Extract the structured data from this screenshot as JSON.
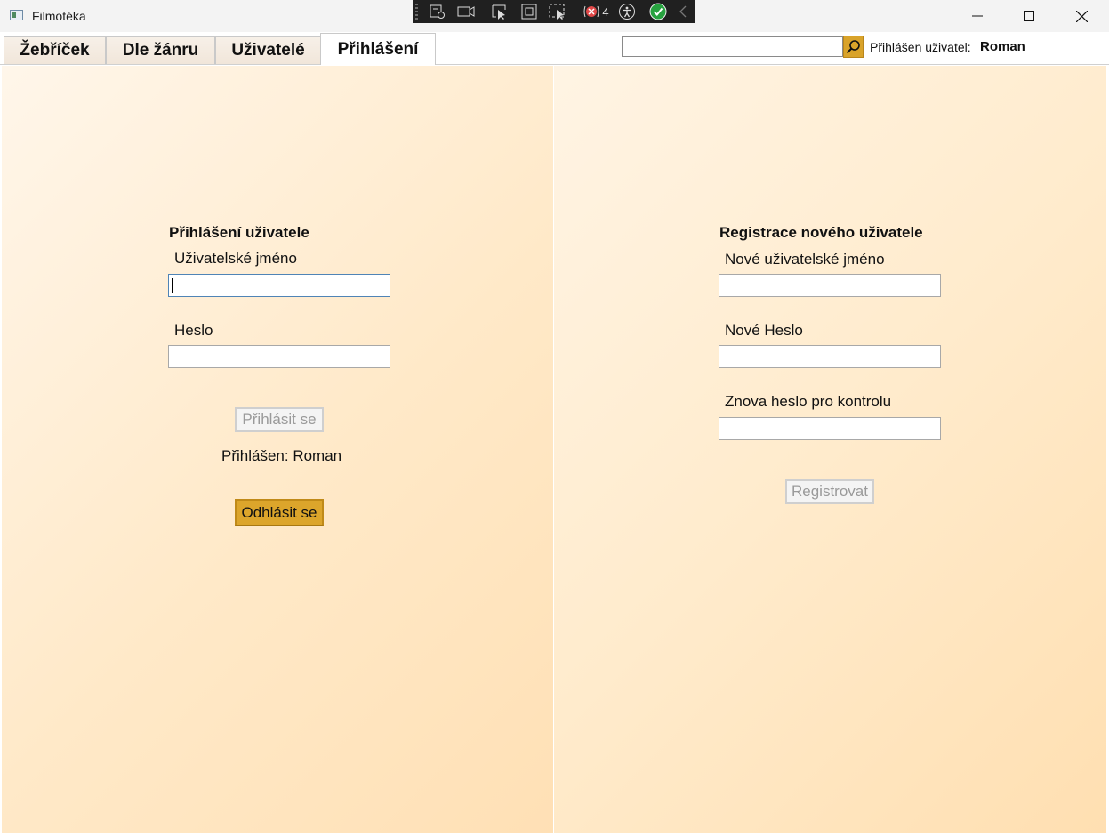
{
  "window": {
    "title": "Filmotéka",
    "icon": "app-window-icon",
    "controls": [
      "minimize-icon",
      "maximize-icon",
      "close-icon"
    ]
  },
  "debug_toolbar": {
    "icons": [
      "live-visual-tree-icon",
      "camera-icon",
      "select-element-icon",
      "display-layout-adorners-icon",
      "track-focus-icon",
      "binding-failures-icon",
      "accessibility-icon",
      "check-icon",
      "chevron-left-icon"
    ],
    "binding_failures_count": "4"
  },
  "tabs": [
    {
      "label": "Žebříček",
      "active": false
    },
    {
      "label": "Dle žánru",
      "active": false
    },
    {
      "label": "Uživatelé",
      "active": false
    },
    {
      "label": "Přihlášení",
      "active": true
    }
  ],
  "header": {
    "search_value": "",
    "search_icon": "search-icon",
    "logged_label": "Přihlášen uživatel:",
    "logged_user": "Roman"
  },
  "login": {
    "title": "Přihlášení uživatele",
    "username_label": "Uživatelské jméno",
    "username_value": "",
    "password_label": "Heslo",
    "password_value": "",
    "login_button": "Přihlásit se",
    "status": "Přihlášen: Roman",
    "logout_button": "Odhlásit se"
  },
  "register": {
    "title": "Registrace nového uživatele",
    "username_label": "Nové uživatelské jméno",
    "password_label": "Nové Heslo",
    "confirm_label": "Znova heslo pro kontrolu",
    "register_button": "Registrovat"
  },
  "colors": {
    "accent_gold": "#dca52b",
    "pane_background": "#ffe6c2"
  }
}
